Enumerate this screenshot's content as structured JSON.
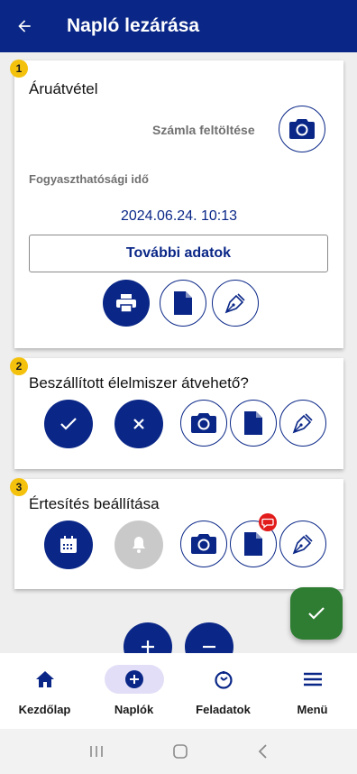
{
  "header": {
    "title": "Napló lezárása",
    "back_icon": "arrow-left-icon"
  },
  "cards": [
    {
      "badge": "1",
      "title": "Áruátvétel",
      "invoice_label": "Számla feltöltése",
      "expiry_label": "Fogyaszthatósági idő",
      "expiry_value": "2024.06.24. 10:13",
      "more_button": "További adatok",
      "actions": [
        "print-icon",
        "document-icon",
        "signature-pen-icon"
      ]
    },
    {
      "badge": "2",
      "title": "Beszállított élelmiszer átvehető?",
      "actions": [
        "check-icon",
        "close-icon",
        "camera-icon",
        "document-icon",
        "signature-pen-icon"
      ]
    },
    {
      "badge": "3",
      "title": "Értesítés beállítása",
      "actions": [
        "calendar-icon",
        "bell-icon",
        "camera-icon",
        "document-icon",
        "signature-pen-icon"
      ]
    }
  ],
  "nav": {
    "items": [
      {
        "label": "Kezdőlap",
        "icon": "home-icon"
      },
      {
        "label": "Naplók",
        "icon": "add-circle-icon",
        "active": true
      },
      {
        "label": "Feladatok",
        "icon": "timer-icon"
      },
      {
        "label": "Menü",
        "icon": "menu-icon"
      }
    ]
  },
  "colors": {
    "primary": "#0a2787",
    "success": "#2e7d32",
    "badge": "#f4c20d",
    "alert": "#e21b1b",
    "active_nav": "#e3def7"
  }
}
